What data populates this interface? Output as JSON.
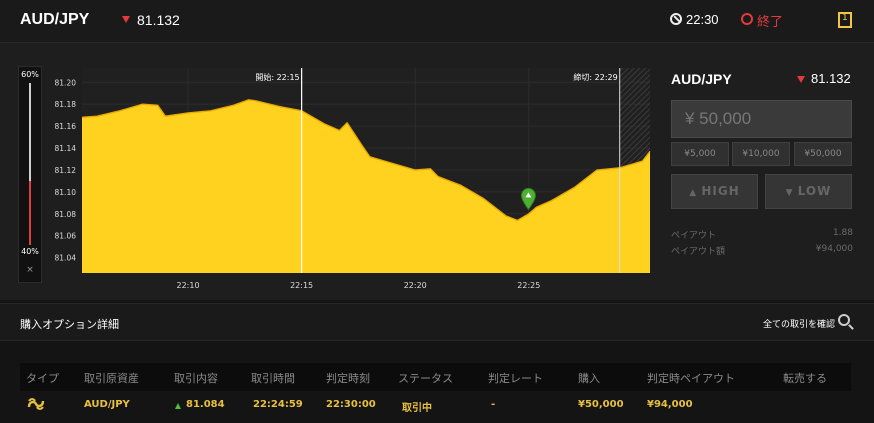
{
  "header": {
    "pair": "AUD/JPY",
    "rate": "81.132",
    "time": "22:30",
    "end_label": "終了"
  },
  "slider": {
    "top_label": "60%",
    "bottom_label": "40%",
    "close": "×",
    "level": 0.6
  },
  "chart_data": {
    "type": "area",
    "x_ticks": [
      "22:10",
      "22:15",
      "22:20",
      "22:25"
    ],
    "y_ticks": [
      "81.20",
      "81.18",
      "81.16",
      "81.14",
      "81.12",
      "81.10",
      "81.08",
      "81.06",
      "81.04"
    ],
    "ylim": [
      81.026,
      81.213
    ],
    "start_label": "開始: 22:15",
    "close_label": "締切: 22:29",
    "entry_rate": 81.084,
    "x": [
      "22:05:20",
      "22:06:00",
      "22:07:00",
      "22:08:00",
      "22:08:40",
      "22:09:00",
      "22:10:00",
      "22:11:00",
      "22:12:00",
      "22:12:40",
      "22:13:00",
      "22:14:00",
      "22:15:00",
      "22:16:00",
      "22:16:40",
      "22:17:00",
      "22:17:40",
      "22:18:00",
      "22:19:00",
      "22:20:00",
      "22:20:40",
      "22:21:00",
      "22:22:00",
      "22:23:00",
      "22:24:00",
      "22:24:30",
      "22:25:00",
      "22:25:20",
      "22:26:00",
      "22:27:00",
      "22:28:00",
      "22:29:00",
      "22:30:00",
      "22:30:20"
    ],
    "values": [
      81.168,
      81.169,
      81.174,
      81.18,
      81.179,
      81.169,
      81.172,
      81.174,
      81.179,
      81.184,
      81.183,
      81.178,
      81.174,
      81.162,
      81.156,
      81.163,
      81.142,
      81.132,
      81.126,
      81.12,
      81.121,
      81.114,
      81.106,
      81.094,
      81.078,
      81.074,
      81.08,
      81.086,
      81.092,
      81.104,
      81.12,
      81.122,
      81.128,
      81.137
    ],
    "color": "#ffd21f"
  },
  "trade_panel": {
    "pair": "AUD/JPY",
    "rate": "81.132",
    "amount_placeholder": "¥ 50,000",
    "presets": [
      "¥5,000",
      "¥10,000",
      "¥50,000"
    ],
    "high": "HIGH",
    "low": "LOW",
    "payout_label": "ペイアウト",
    "payout_value": "1.88",
    "payout_amount_label": "ペイアウト額",
    "payout_amount_value": "¥94,000"
  },
  "details": {
    "title": "購入オプション詳細",
    "all_trades": "全ての取引を確認",
    "columns": [
      "タイプ",
      "取引原資産",
      "取引内容",
      "取引時間",
      "判定時刻",
      "ステータス",
      "判定レート",
      "購入",
      "判定時ペイアウト",
      "転売する"
    ],
    "row": {
      "asset": "AUD/JPY",
      "rate": "81.084",
      "trade_time": "22:24:59",
      "judge_time": "22:30:00",
      "status": "取引中",
      "judge_rate": "-",
      "purchase": "¥50,000",
      "payout": "¥94,000"
    }
  }
}
